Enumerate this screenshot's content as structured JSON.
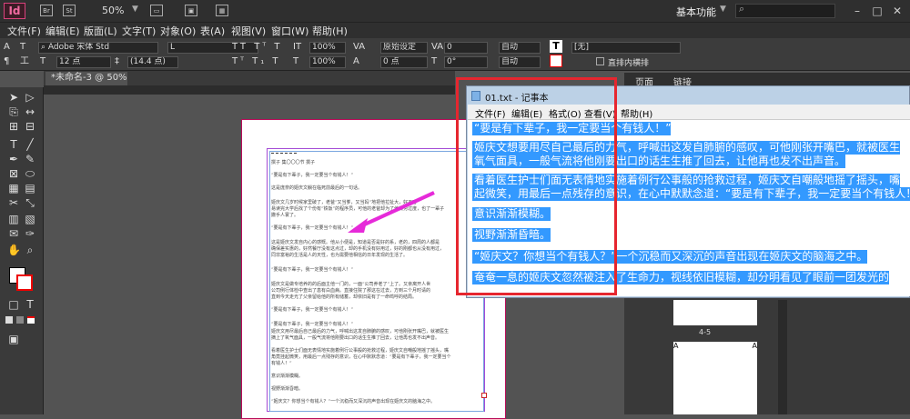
{
  "app": {
    "logo": "Id",
    "icon_br": "Br",
    "icon_st": "St",
    "zoom": "50%",
    "workspace": "基本功能"
  },
  "menu": [
    "文件(F)",
    "编辑(E)",
    "版面(L)",
    "文字(T)",
    "对象(O)",
    "表(A)",
    "视图(V)",
    "窗口(W)",
    "帮助(H)"
  ],
  "control": {
    "font_name": "Adobe 宋体 Std",
    "font_style": "L",
    "font_size": "12 点",
    "leading": "(14.4 点)",
    "scale_h": "100%",
    "scale_v": "100%",
    "kerning": "原始设定",
    "tracking": "0",
    "baseline": "0 点",
    "skew": "0°",
    "auto1": "自动",
    "auto2": "自动",
    "char_style": "[无]",
    "vertical_label": "直排内横排"
  },
  "document": {
    "tab_label": "*未命名-3 @ 50%"
  },
  "page_lines": [
    "撰子 集〇〇〇节 撰子",
    "“要是有下辈子，我一定要当个有钱人！”",
    "这是庞奈的姬庆文躺在临死前最后的一句话。",
    "姬庆文几岁时候家里破了，老爸“又当爹，又当妈”地把他拉扯大，好不容",
    "易读完大学后找了个份有“铁饭”的程序员，可他的老爸却为了他操劳过度，也了一辈子",
    "撒手人寰了。",
    "“要是有下辈子，我一定要当个有钱人！”",
    "这是姬庆文发自内心的感慨。他从小便是，知道是否是好的系，老的，四周的人都是",
    "确保差实惠的，好然餐厅没有这点过，却的手机没有好用过，好的刚都也从没有用过，",
    "同非富裕的生活是人的天性，也为需要他相信的日年发现的生活了。",
    "“要是有下辈子，我一定要当个有钱人！”",
    "姬庆文是做专培养的的后面主他一门的，一面“公司养老了”上了。又亲离开人世",
    "公司例行体检中查出了患有白血病。直接住院了那这在过去，方到三个月时请的",
    "直到今天走光了父亲留给他的所有储蓄，却依旧是有了一命鸣呼的结局。",
    "“要是有下辈子，我一定要当个有钱人！”",
    "“要是有下辈子，我一定要当个有钱人！”",
    "姬庆文用尽最后自己最后的力气，呼喊出这发自肺腑的感叹，可他刚张开嘴巴，就被医生",
    "摘上了氧气面具，一般气流将他刚要出口的话生生推了回去，让他再也发不出声音。",
    "看着医生护士们面无表情地实施着例行公事般的抢救过程，姬庆文自嘲般地摇了摇头，嘴",
    "角竟挂起微笑，用最后一点残存的意识，在心中默默念道：“要是有下辈子，我一定要当个",
    "有钱人！”",
    "意识渐渐模糊。",
    "视野渐渐昏暗。",
    "“姬庆文？你想当个有钱人？”一个沉稳而又深沉的声音出现在姬庆文的脑海之中。"
  ],
  "pages_panel": {
    "tab1": "页面",
    "tab2": "链接",
    "spread_label": "4-5",
    "master_a": "A"
  },
  "notepad": {
    "title": "01.txt - 记事本",
    "menu": [
      "文件(F)",
      "编辑(E)",
      "格式(O)",
      "查看(V)",
      "帮助(H)"
    ],
    "lines": [
      "“要是有下辈子，我一定要当个有钱人！”",
      "姬庆文想要用尽自己最后的力气，呼喊出这发自肺腑的感叹，可他刚张开嘴巴，就被医生",
      "氧气面具，一般气流将他刚要出口的话生生推了回去，让他再也发不出声音。",
      "看着医生护士们面无表情地实施着例行公事般的抢救过程，姬庆文自嘲般地摇了摇头，嘴",
      "起微笑，用最后一点残存的意识，在心中默默念道：“要是有下辈子，我一定要当个有钱人！",
      "意识渐渐模糊。",
      "视野渐渐昏暗。",
      "“姬庆文？你想当个有钱人？”一个沉稳而又深沉的声音出现在姬庆文的脑海之中。",
      "奄奄一息的姬庆文忽然被注入了生命力，视线依旧模糊，却分明看见了眼前一团发光的"
    ]
  },
  "colors": {
    "highlight": "#3399ff",
    "annotation_red": "#e6262f",
    "arrow_magenta": "#e62ad9",
    "page_border": "#b90c59"
  }
}
